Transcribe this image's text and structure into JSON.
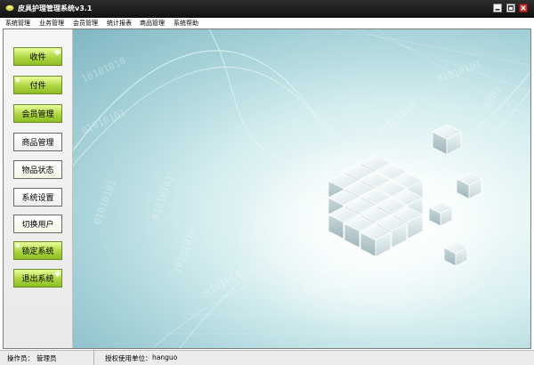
{
  "window": {
    "title": "皮具护理管理系统v3.1",
    "controls": [
      "minimize",
      "maximize",
      "close"
    ]
  },
  "menu": [
    {
      "label": "系统管理"
    },
    {
      "label": "业务管理"
    },
    {
      "label": "会员管理"
    },
    {
      "label": "统计报表"
    },
    {
      "label": "商品管理"
    },
    {
      "label": "系统帮助"
    }
  ],
  "nav": [
    {
      "label": "收件",
      "style": "green"
    },
    {
      "label": "付件",
      "style": "green"
    },
    {
      "label": "会员管理",
      "style": "green"
    },
    {
      "label": "商品管理",
      "style": "white"
    },
    {
      "label": "物品状态",
      "style": "white"
    },
    {
      "label": "系统设置",
      "style": "white"
    },
    {
      "label": "切换用户",
      "style": "white"
    },
    {
      "label": "锁定系统",
      "style": "green"
    },
    {
      "label": "退出系统",
      "style": "green"
    }
  ],
  "splash": {
    "binary_text": "01010101 01010101 01010101"
  },
  "status": {
    "operator_label": "操作员：",
    "operator_value": "管理员",
    "licensed_label": "授权使用单位：",
    "licensed_value": "hanguo"
  },
  "colors": {
    "titlebar": "#1a1a1a",
    "nav_green": "#a9d23b",
    "splash_teal": "#8fc3cc",
    "close_red": "#c8302a"
  }
}
